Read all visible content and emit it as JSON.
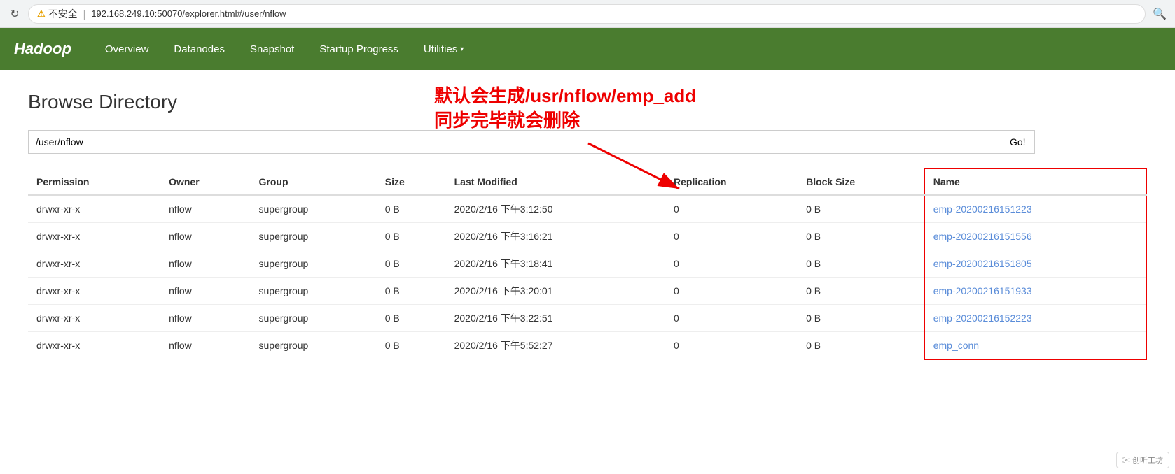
{
  "browser": {
    "reload_icon": "↻",
    "warning_label": "不安全",
    "url": "192.168.249.10:50070/explorer.html#/user/nflow",
    "search_icon": "🔍"
  },
  "navbar": {
    "brand": "Hadoop",
    "items": [
      {
        "label": "Overview",
        "id": "overview"
      },
      {
        "label": "Datanodes",
        "id": "datanodes"
      },
      {
        "label": "Snapshot",
        "id": "snapshot"
      },
      {
        "label": "Startup Progress",
        "id": "startup-progress"
      },
      {
        "label": "Utilities",
        "id": "utilities",
        "dropdown": true
      }
    ]
  },
  "page": {
    "title": "Browse Directory",
    "path_value": "/user/nflow",
    "go_button": "Go!",
    "annotation_line1": "默认会生成/usr/nflow/emp_add",
    "annotation_line2": "同步完毕就会删除"
  },
  "table": {
    "headers": [
      "Permission",
      "Owner",
      "Group",
      "Size",
      "Last Modified",
      "Replication",
      "Block Size",
      "Name"
    ],
    "rows": [
      {
        "permission": "drwxr-xr-x",
        "owner": "nflow",
        "group": "supergroup",
        "size": "0 B",
        "last_modified": "2020/2/16 下午3:12:50",
        "replication": "0",
        "block_size": "0 B",
        "name": "emp-20200216151223",
        "name_link": "#"
      },
      {
        "permission": "drwxr-xr-x",
        "owner": "nflow",
        "group": "supergroup",
        "size": "0 B",
        "last_modified": "2020/2/16 下午3:16:21",
        "replication": "0",
        "block_size": "0 B",
        "name": "emp-20200216151556",
        "name_link": "#"
      },
      {
        "permission": "drwxr-xr-x",
        "owner": "nflow",
        "group": "supergroup",
        "size": "0 B",
        "last_modified": "2020/2/16 下午3:18:41",
        "replication": "0",
        "block_size": "0 B",
        "name": "emp-20200216151805",
        "name_link": "#"
      },
      {
        "permission": "drwxr-xr-x",
        "owner": "nflow",
        "group": "supergroup",
        "size": "0 B",
        "last_modified": "2020/2/16 下午3:20:01",
        "replication": "0",
        "block_size": "0 B",
        "name": "emp-20200216151933",
        "name_link": "#"
      },
      {
        "permission": "drwxr-xr-x",
        "owner": "nflow",
        "group": "supergroup",
        "size": "0 B",
        "last_modified": "2020/2/16 下午3:22:51",
        "replication": "0",
        "block_size": "0 B",
        "name": "emp-20200216152223",
        "name_link": "#"
      },
      {
        "permission": "drwxr-xr-x",
        "owner": "nflow",
        "group": "supergroup",
        "size": "0 B",
        "last_modified": "2020/2/16 下午5:52:27",
        "replication": "0",
        "block_size": "0 B",
        "name": "emp_conn",
        "name_link": "#"
      }
    ]
  },
  "watermark": "创听工坊"
}
